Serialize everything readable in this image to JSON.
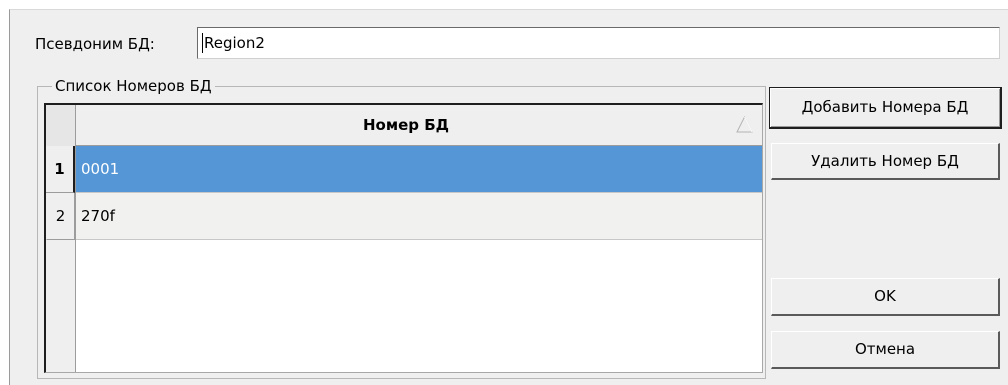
{
  "alias": {
    "label": "Псевдоним БД:",
    "value": "Region2"
  },
  "list": {
    "group_title": "Список Номеров БД",
    "column_header": "Номер БД",
    "rows": [
      {
        "index": "1",
        "value": "0001",
        "selected": true
      },
      {
        "index": "2",
        "value": "270f",
        "selected": false
      }
    ]
  },
  "buttons": {
    "add": "Добавить Номера БД",
    "delete": "Удалить Номер БД",
    "ok": "OK",
    "cancel": "Отмена"
  },
  "colors": {
    "selection": "#5596d6",
    "dialog_background": "#efefef"
  },
  "icons": {
    "sort": "sort-ascending-icon"
  }
}
